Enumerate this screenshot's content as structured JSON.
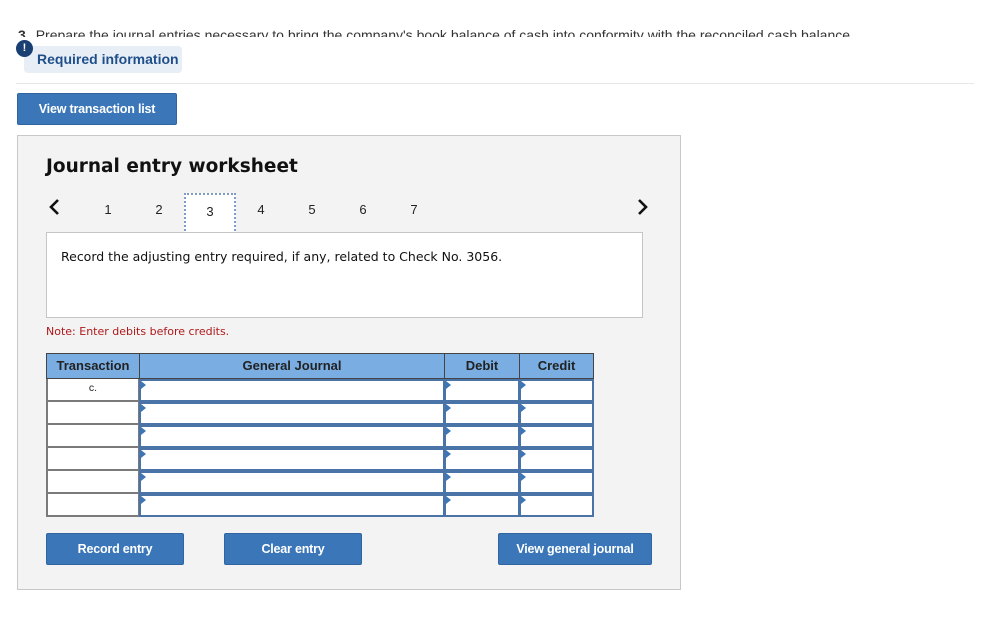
{
  "question": {
    "number": "3.",
    "text": "Prepare the journal entries necessary to bring the company's book balance of cash into conformity with the reconciled cash balance."
  },
  "required_info": {
    "badge": "!",
    "label": "Required information"
  },
  "buttons": {
    "view_transaction_list": "View transaction list",
    "record_entry": "Record entry",
    "clear_entry": "Clear entry",
    "view_general_journal": "View general journal"
  },
  "worksheet": {
    "title": "Journal entry worksheet",
    "pager": {
      "prev_icon": "chevron-left-icon",
      "next_icon": "chevron-right-icon",
      "pages": [
        "1",
        "2",
        "3",
        "4",
        "5",
        "6",
        "7"
      ],
      "current": "3"
    },
    "prompt": "Record the adjusting entry required, if any, related to Check No. 3056.",
    "note": "Note: Enter debits before credits.",
    "table": {
      "headers": {
        "transaction": "Transaction",
        "general_journal": "General Journal",
        "debit": "Debit",
        "credit": "Credit"
      },
      "rows": [
        {
          "transaction": "c.",
          "account": "",
          "debit": "",
          "credit": ""
        },
        {
          "transaction": "",
          "account": "",
          "debit": "",
          "credit": ""
        },
        {
          "transaction": "",
          "account": "",
          "debit": "",
          "credit": ""
        },
        {
          "transaction": "",
          "account": "",
          "debit": "",
          "credit": ""
        },
        {
          "transaction": "",
          "account": "",
          "debit": "",
          "credit": ""
        },
        {
          "transaction": "",
          "account": "",
          "debit": "",
          "credit": ""
        }
      ]
    }
  },
  "colors": {
    "accent_button": "#3a76b8",
    "table_header": "#7aaee3",
    "note_red": "#b0181b",
    "badge": "#1a3f73"
  }
}
